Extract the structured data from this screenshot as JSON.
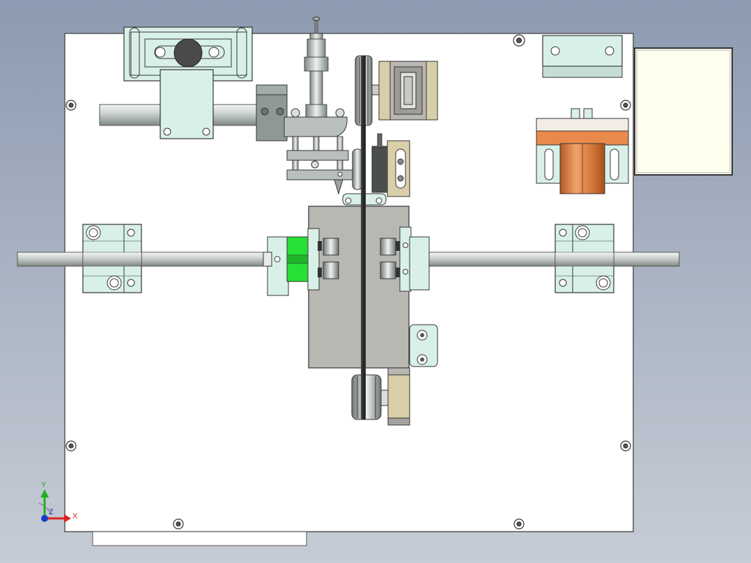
{
  "view": {
    "background_top": "#8c9bb1",
    "background_bottom": "#c6ccd6",
    "plate_color": "#ffffff",
    "part_color": "#d8f0e8",
    "steel_color": "#b9c0bb",
    "gray_block_color": "#b8b7b2",
    "highlight_green": "#27e035",
    "copper_color": "#d9834a",
    "tan_color": "#d8cfa8"
  },
  "triad": {
    "y_label": "Y",
    "x_label": "X",
    "z_label": "Z",
    "x_color": "#e02020",
    "y_color": "#20b020",
    "z_color": "#1a3cc8"
  }
}
